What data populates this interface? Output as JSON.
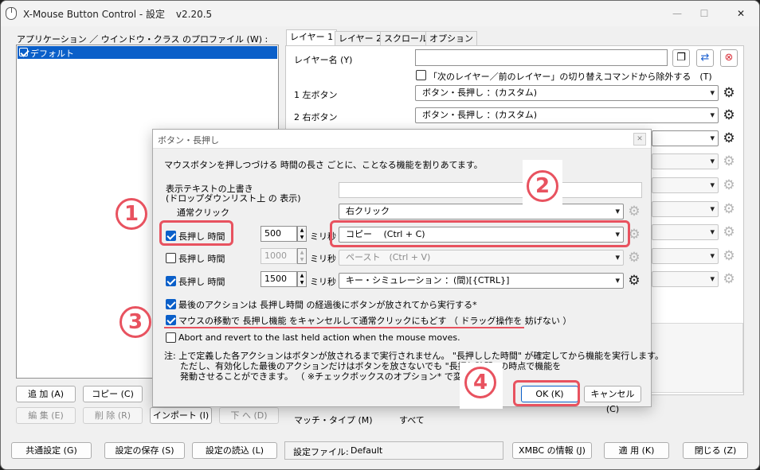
{
  "window": {
    "title": "X-Mouse Button Control - 設定",
    "version": "v2.20.5"
  },
  "left_panel": {
    "label": "アプリケーション ／ ウインドウ・クラス のプロファイル (W) :",
    "profiles": [
      {
        "name": "デフォルト",
        "checked": true
      }
    ],
    "buttons": {
      "add": "追 加 (A)",
      "copy": "コピー (C)",
      "edit": "編 集 (E)",
      "delete": "削 除 (R)",
      "import": "インポート (I)",
      "down": "下 へ (D)"
    }
  },
  "tabs": [
    "レイヤー 1",
    "レイヤー 2",
    "スクロール",
    "オプション"
  ],
  "layer": {
    "name_label": "レイヤー名 (Y)",
    "name_value": "",
    "exclude_checkbox": "「次のレイヤー／前のレイヤー」の切り替えコマンドから除外する　(T)",
    "rows": [
      {
        "label": "1  左ボタン",
        "value": "ボタン・長押し ：(カスタム)"
      },
      {
        "label": "2  右ボタン",
        "value": "ボタン・長押し ：(カスタム)"
      }
    ],
    "match_type_label": "マッチ・タイプ (M)",
    "match_type_value": "すべて"
  },
  "dialog": {
    "title": "ボタン・長押し",
    "description": "マウスボタンを押しつづける 時間の長さ ごとに、ことなる機能を割りあてます。",
    "override_label_1": "表示テキストの上書き",
    "override_label_2": "(ドロップダウンリスト上 の 表示)",
    "override_value": "",
    "normal_click_label": "通常クリック",
    "normal_click_value": "右クリック",
    "hold_rows": [
      {
        "label": "長押し 時間",
        "checked": true,
        "ms": "500",
        "unit": "ミリ秒",
        "action": "コピー　 (Ctrl + C)",
        "enabled": true
      },
      {
        "label": "長押し 時間",
        "checked": false,
        "ms": "1000",
        "unit": "ミリ秒",
        "action": "ペースト　(Ctrl + V)",
        "enabled": false
      },
      {
        "label": "長押し 時間",
        "checked": true,
        "ms": "1500",
        "unit": "ミリ秒",
        "action": "キー・シミュレーション ：(間)[{CTRL}]",
        "enabled": true
      }
    ],
    "options": [
      {
        "text": "最後のアクションは 長押し時間 の経過後にボタンが放されてから実行する*",
        "checked": true
      },
      {
        "text": "マウスの移動で 長押し機能 をキャンセルして通常クリックにもどす （ ドラッグ操作を 妨げない ）",
        "checked": true
      },
      {
        "text": "Abort and revert to the last held action when the mouse moves.",
        "checked": false
      }
    ],
    "note_lines": [
      "注:  上で定義した各アクションはボタンが放されるまで実行されません。 \"長押しした時間\" が確定してから機能を実行します。",
      "ただし、有効化した最後のアクションだけはボタンを放さないでも \"長押し時間\" の時点で機能を",
      "発動させることができます。 （ ※チェックボックスのオプション* で変更可 ）"
    ],
    "ok": "OK (K)",
    "cancel": "キャンセル (C)"
  },
  "annotations": {
    "n1": "1",
    "n2": "2",
    "n3": "3",
    "n4": "4",
    "color": "#e8525f"
  },
  "bottom_bar": {
    "common_settings": "共通設定 (G)",
    "save": "設定の保存 (S)",
    "load": "設定の読込 (L)",
    "settings_file_label": "設定ファイル:",
    "settings_file_value": "Default",
    "about": "XMBC の情報 (J)",
    "apply": "適 用 (K)",
    "close": "閉じる (Z)"
  }
}
